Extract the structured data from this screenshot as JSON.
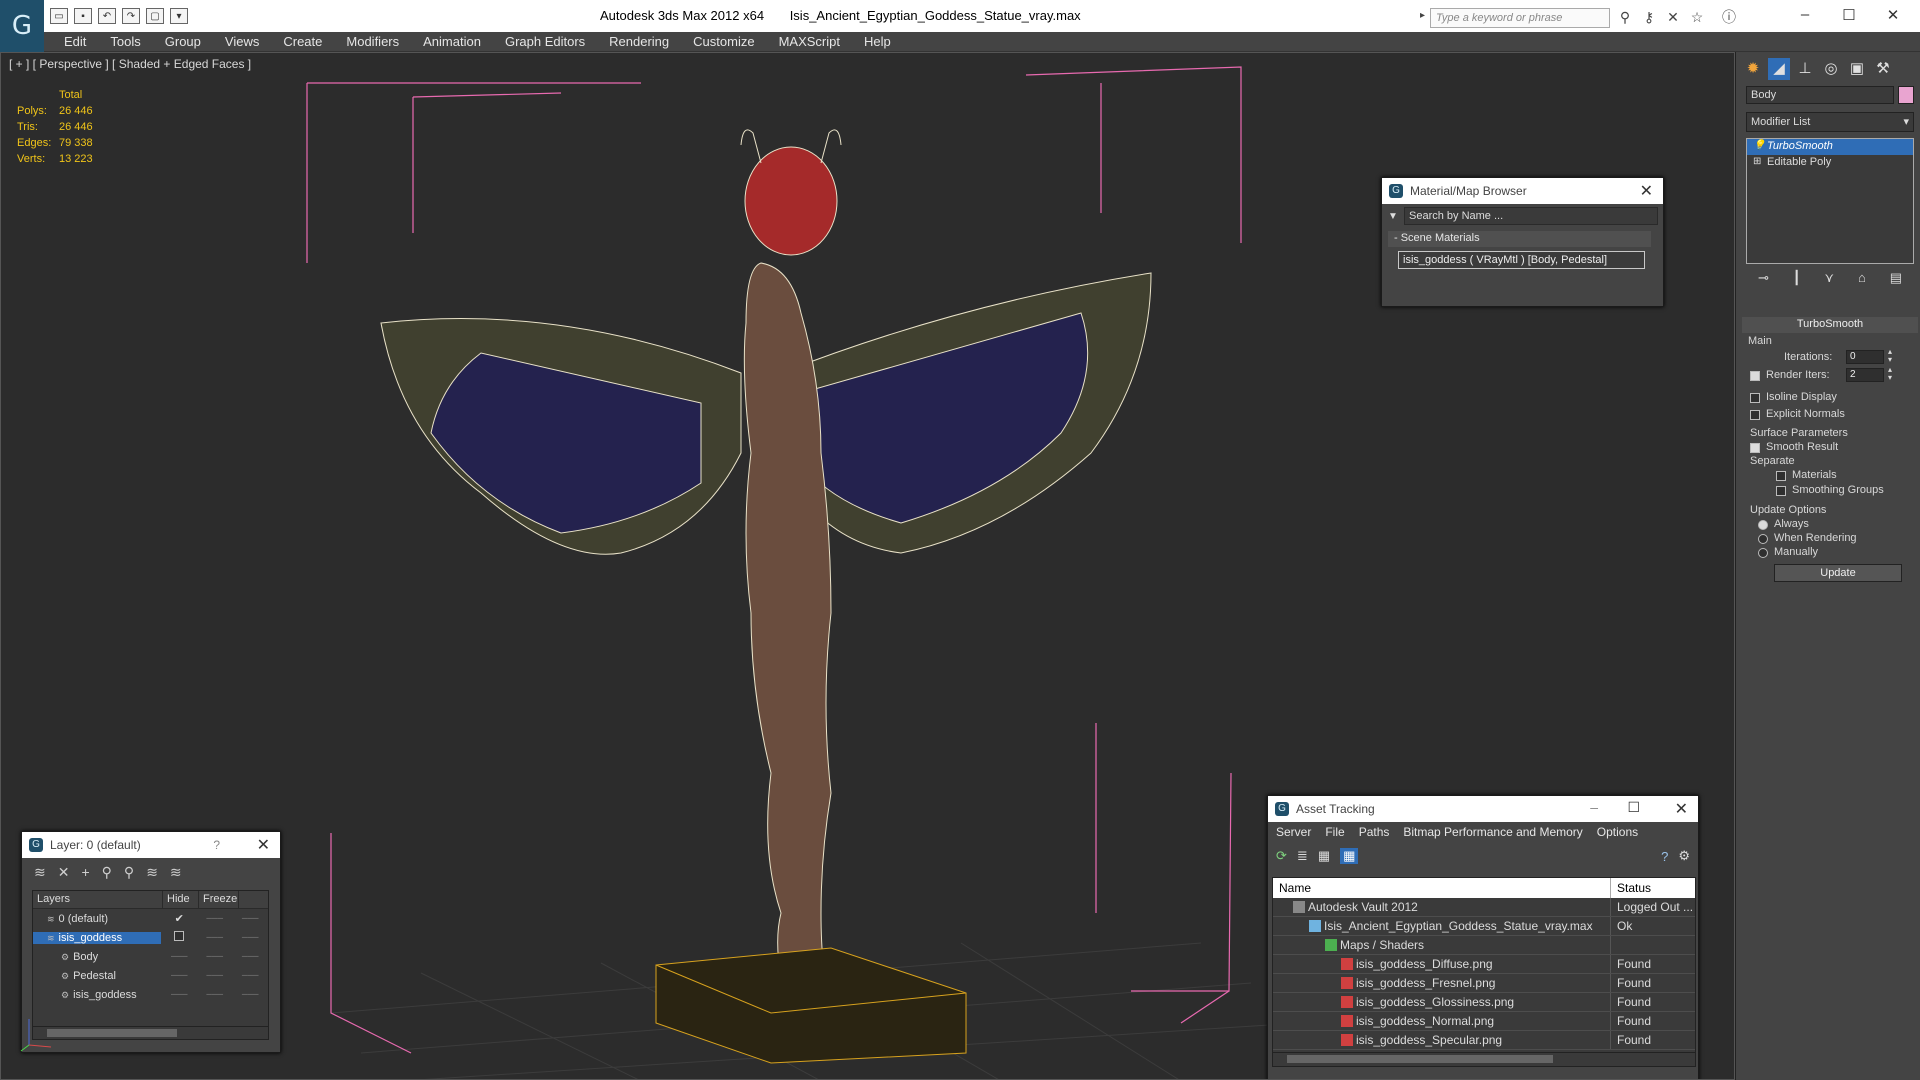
{
  "titlebar": {
    "app": "Autodesk 3ds Max  2012 x64",
    "file": "Isis_Ancient_Egyptian_Goddess_Statue_vray.max",
    "search_placeholder": "Type a keyword or phrase"
  },
  "menu": [
    "Edit",
    "Tools",
    "Group",
    "Views",
    "Create",
    "Modifiers",
    "Animation",
    "Graph Editors",
    "Rendering",
    "Customize",
    "MAXScript",
    "Help"
  ],
  "viewport": {
    "label": "[ + ] [ Perspective ] [ Shaded + Edged Faces ]",
    "stats_header": "Total",
    "stats": [
      {
        "label": "Polys:",
        "value": "26 446"
      },
      {
        "label": "Tris:",
        "value": "26 446"
      },
      {
        "label": "Edges:",
        "value": "79 338"
      },
      {
        "label": "Verts:",
        "value": "13 223"
      }
    ]
  },
  "material_browser": {
    "title": "Material/Map Browser",
    "search_placeholder": "Search by Name ...",
    "section": "- Scene Materials",
    "item": "isis_goddess ( VRayMtl ) [Body, Pedestal]"
  },
  "layer_manager": {
    "title": "Layer: 0 (default)",
    "help": "?",
    "columns": [
      "Layers",
      "Hide",
      "Freeze"
    ],
    "rows": [
      {
        "name": "0 (default)",
        "indent": 0,
        "selected": false
      },
      {
        "name": "isis_goddess",
        "indent": 0,
        "selected": true
      },
      {
        "name": "Body",
        "indent": 1,
        "selected": false
      },
      {
        "name": "Pedestal",
        "indent": 1,
        "selected": false
      },
      {
        "name": "isis_goddess",
        "indent": 1,
        "selected": false
      }
    ]
  },
  "asset_tracking": {
    "title": "Asset Tracking",
    "menu": [
      "Server",
      "File",
      "Paths",
      "Bitmap Performance and Memory",
      "Options"
    ],
    "columns": [
      "Name",
      "Status"
    ],
    "rows": [
      {
        "name": "Autodesk Vault 2012",
        "status": "Logged Out ...",
        "indent": 0
      },
      {
        "name": "Isis_Ancient_Egyptian_Goddess_Statue_vray.max",
        "status": "Ok",
        "indent": 1
      },
      {
        "name": "Maps / Shaders",
        "status": "",
        "indent": 2
      },
      {
        "name": "isis_goddess_Diffuse.png",
        "status": "Found",
        "indent": 3
      },
      {
        "name": "isis_goddess_Fresnel.png",
        "status": "Found",
        "indent": 3
      },
      {
        "name": "isis_goddess_Glossiness.png",
        "status": "Found",
        "indent": 3
      },
      {
        "name": "isis_goddess_Normal.png",
        "status": "Found",
        "indent": 3
      },
      {
        "name": "isis_goddess_Specular.png",
        "status": "Found",
        "indent": 3
      }
    ]
  },
  "command_panel": {
    "object_name": "Body",
    "object_color": "#e9a4d0",
    "modifier_list": "Modifier List",
    "stack": [
      {
        "name": "TurboSmooth",
        "selected": true
      },
      {
        "name": "Editable Poly",
        "selected": false
      }
    ],
    "rollout_title": "TurboSmooth",
    "main_label": "Main",
    "iterations_label": "Iterations:",
    "iterations_value": "0",
    "render_iters_label": "Render Iters:",
    "render_iters_value": "2",
    "isoline_label": "Isoline Display",
    "explicit_label": "Explicit Normals",
    "surface_label": "Surface Parameters",
    "smooth_result_label": "Smooth Result",
    "separate_label": "Separate",
    "materials_label": "Materials",
    "smoothing_groups_label": "Smoothing Groups",
    "update_options_label": "Update Options",
    "radio_always": "Always",
    "radio_when_rendering": "When Rendering",
    "radio_manually": "Manually",
    "update_button": "Update"
  },
  "colors": {
    "accent_blue": "#2f6db6",
    "stats_yellow": "#f0c419",
    "bbox_pink": "#e86ab0"
  }
}
